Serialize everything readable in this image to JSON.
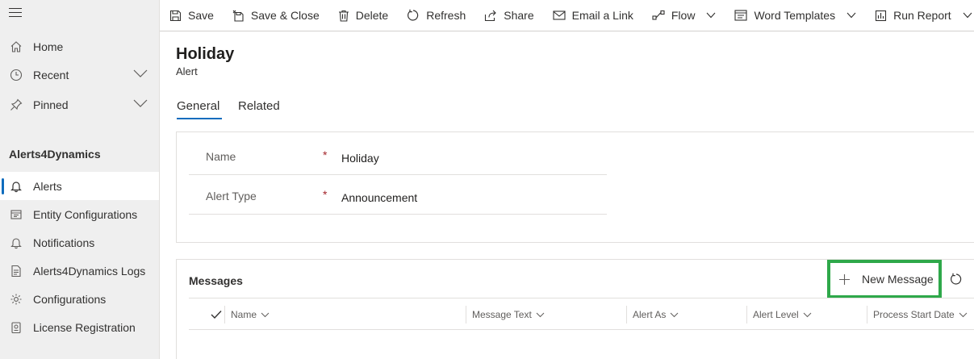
{
  "sidebar": {
    "home": "Home",
    "recent": "Recent",
    "pinned": "Pinned",
    "section_title": "Alerts4Dynamics",
    "items": [
      {
        "label": "Alerts",
        "icon": "bell-icon",
        "active": true
      },
      {
        "label": "Entity Configurations",
        "icon": "entity-config-icon"
      },
      {
        "label": "Notifications",
        "icon": "bell-icon"
      },
      {
        "label": "Alerts4Dynamics Logs",
        "icon": "log-icon"
      },
      {
        "label": "Configurations",
        "icon": "settings-icon"
      },
      {
        "label": "License Registration",
        "icon": "license-icon"
      }
    ]
  },
  "toolbar": {
    "save": "Save",
    "save_close": "Save & Close",
    "delete": "Delete",
    "refresh": "Refresh",
    "share": "Share",
    "email_link": "Email a Link",
    "flow": "Flow",
    "word_templates": "Word Templates",
    "run_report": "Run Report"
  },
  "record": {
    "title": "Holiday",
    "entity": "Alert"
  },
  "tabs": {
    "general": "General",
    "related": "Related"
  },
  "form": {
    "name_label": "Name",
    "name_value": "Holiday",
    "type_label": "Alert Type",
    "type_value": "Announcement",
    "required_mark": "*"
  },
  "messages": {
    "title": "Messages",
    "new_button": "New Message",
    "columns": [
      "Name",
      "Message Text",
      "Alert As",
      "Alert Level",
      "Process Start Date"
    ]
  },
  "colors": {
    "accent": "#0f6cbd",
    "highlight": "#2ea84a",
    "required": "#a4262c"
  }
}
